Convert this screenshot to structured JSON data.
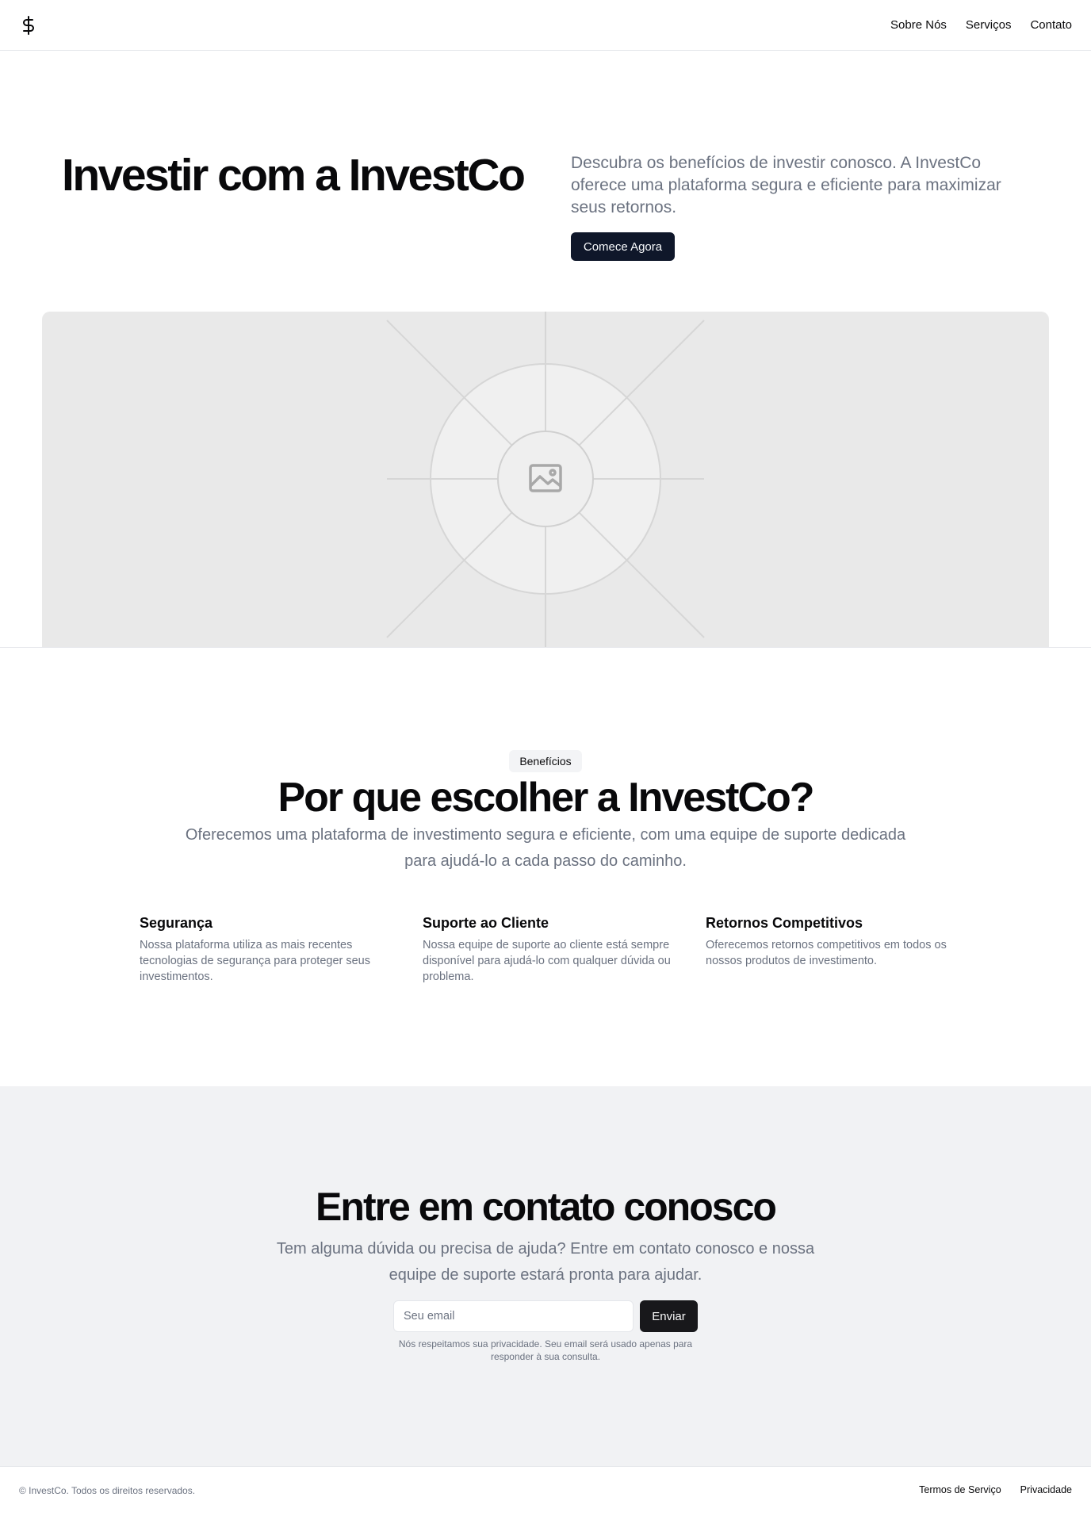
{
  "header": {
    "logo_icon": "dollar-sign-icon",
    "nav": [
      {
        "label": "Sobre Nós"
      },
      {
        "label": "Serviços"
      },
      {
        "label": "Contato"
      }
    ]
  },
  "hero": {
    "title": "Investir com a InvestCo",
    "description": "Descubra os benefícios de investir conosco. A InvestCo oferece uma plataforma segura e eficiente para maximizar seus retornos.",
    "cta_label": "Comece Agora",
    "image_icon": "image-placeholder-icon"
  },
  "benefits": {
    "badge": "Benefícios",
    "title": "Por que escolher a InvestCo?",
    "description": "Oferecemos uma plataforma de investimento segura e eficiente, com uma equipe de suporte dedicada para ajudá-lo a cada passo do caminho.",
    "features": [
      {
        "title": "Segurança",
        "text": "Nossa plataforma utiliza as mais recentes tecnologias de segurança para proteger seus investimentos."
      },
      {
        "title": "Suporte ao Cliente",
        "text": "Nossa equipe de suporte ao cliente está sempre disponível para ajudá-lo com qualquer dúvida ou problema."
      },
      {
        "title": "Retornos Competitivos",
        "text": "Oferecemos retornos competitivos em todos os nossos produtos de investimento."
      }
    ]
  },
  "contact": {
    "title": "Entre em contato conosco",
    "description": "Tem alguma dúvida ou precisa de ajuda? Entre em contato conosco e nossa equipe de suporte estará pronta para ajudar.",
    "email_placeholder": "Seu email",
    "email_value": "",
    "submit_label": "Enviar",
    "privacy_note": "Nós respeitamos sua privacidade. Seu email será usado apenas para responder à sua consulta."
  },
  "footer": {
    "copyright": "© InvestCo. Todos os direitos reservados.",
    "links": [
      {
        "label": "Termos de Serviço"
      },
      {
        "label": "Privacidade"
      }
    ]
  },
  "colors": {
    "primary_button": "#0f172a",
    "muted_text": "#6b7280",
    "contact_background": "#f1f2f4",
    "image_placeholder": "#e9e9e9"
  }
}
